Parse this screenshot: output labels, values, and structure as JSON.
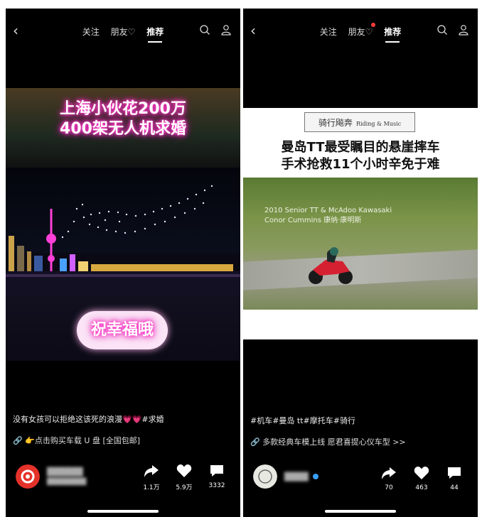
{
  "nav": {
    "tab_follow": "关注",
    "tab_friends": "朋友♡",
    "tab_recommend": "推荐"
  },
  "post1": {
    "overlay_title_1": "上海小伙花200万",
    "overlay_title_2": "400架无人机求婚",
    "sticker": "祝幸福哦",
    "caption": "没有女孩可以拒绝这该死的浪漫💗💗#求婚",
    "promo": "👉点击购买车载 U 盘 [全国包邮]",
    "share_count": "1.1万",
    "like_count": "5.9万",
    "comment_count": "3332"
  },
  "post2": {
    "logo_text": "骑行飚奔",
    "logo_sub": "Riding & Music",
    "headline_1": "曼岛TT最受瞩目的悬崖摔车",
    "headline_2": "手术抢救11个小时辛免于难",
    "video_line_1": "2010 Senior TT & McAdoo Kawasaki",
    "video_line_2": "Conor Cummins  康纳·康明斯",
    "caption": "#机车#曼岛 tt#摩托车#骑行",
    "promo": "多款经典车模上线 愿君喜提心仪车型 >>",
    "share_count": "70",
    "like_count": "463",
    "comment_count": "44"
  },
  "colors": {
    "accent": "#ff3ec8",
    "dot": "#ff3b3b"
  }
}
